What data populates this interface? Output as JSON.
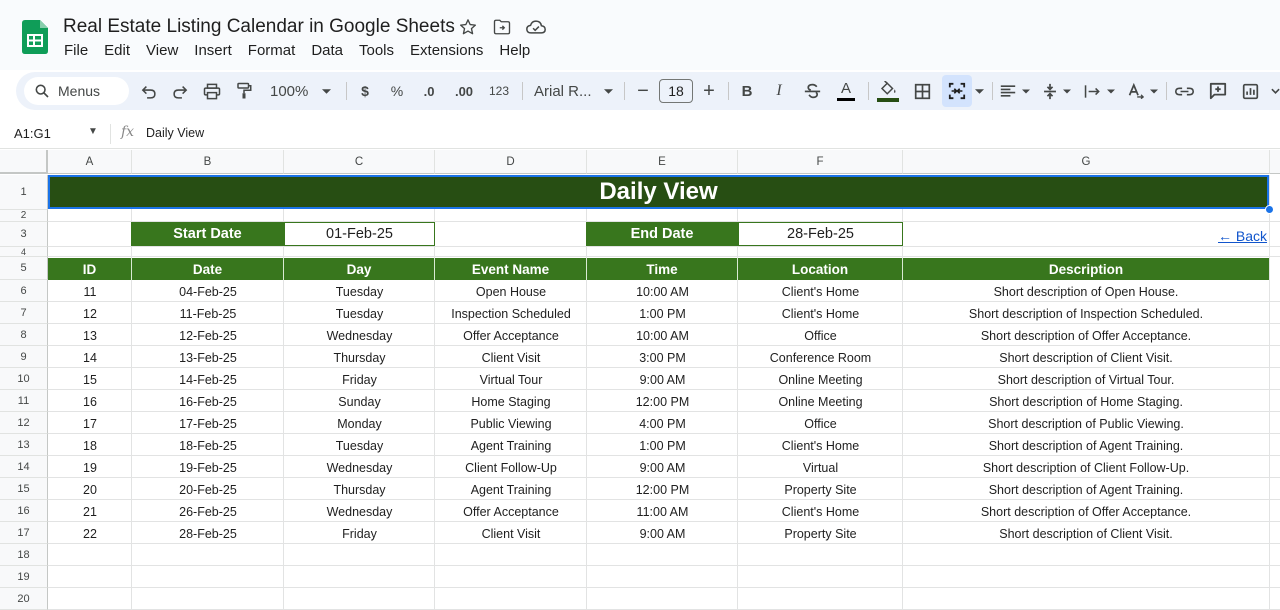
{
  "app": {
    "doc_title": "Real Estate Listing Calendar in Google Sheets",
    "menu": [
      "File",
      "Edit",
      "View",
      "Insert",
      "Format",
      "Data",
      "Tools",
      "Extensions",
      "Help"
    ]
  },
  "toolbar": {
    "menus_label": "Menus",
    "zoom": "100%",
    "currency": "$",
    "percent": "%",
    "dec_decrease": ".0",
    "dec_increase": ".00",
    "number_format": "123",
    "font_name": "Arial R...",
    "font_size": "18",
    "bold": "B",
    "italic": "I",
    "text_color": "A"
  },
  "formula_bar": {
    "name_box": "A1:G1",
    "formula": "Daily View"
  },
  "grid": {
    "columns": [
      "A",
      "B",
      "C",
      "D",
      "E",
      "F",
      "G"
    ],
    "rows": [
      "1",
      "2",
      "3",
      "4",
      "5",
      "6",
      "7",
      "8",
      "9",
      "10",
      "11",
      "12",
      "13",
      "14",
      "15",
      "16",
      "17",
      "18",
      "19",
      "20"
    ]
  },
  "sheet": {
    "banner": "Daily View",
    "start_label": "Start Date",
    "start_value": "01-Feb-25",
    "end_label": "End Date",
    "end_value": "28-Feb-25",
    "back_link": "← Back",
    "headers": [
      "ID",
      "Date",
      "Day",
      "Event Name",
      "Time",
      "Location",
      "Description"
    ],
    "rows": [
      [
        "11",
        "04-Feb-25",
        "Tuesday",
        "Open House",
        "10:00 AM",
        "Client's Home",
        "Short description of Open House."
      ],
      [
        "12",
        "11-Feb-25",
        "Tuesday",
        "Inspection Scheduled",
        "1:00 PM",
        "Client's Home",
        "Short description of Inspection Scheduled."
      ],
      [
        "13",
        "12-Feb-25",
        "Wednesday",
        "Offer Acceptance",
        "10:00 AM",
        "Office",
        "Short description of Offer Acceptance."
      ],
      [
        "14",
        "13-Feb-25",
        "Thursday",
        "Client Visit",
        "3:00 PM",
        "Conference Room",
        "Short description of Client Visit."
      ],
      [
        "15",
        "14-Feb-25",
        "Friday",
        "Virtual Tour",
        "9:00 AM",
        "Online Meeting",
        "Short description of Virtual Tour."
      ],
      [
        "16",
        "16-Feb-25",
        "Sunday",
        "Home Staging",
        "12:00 PM",
        "Online Meeting",
        "Short description of Home Staging."
      ],
      [
        "17",
        "17-Feb-25",
        "Monday",
        "Public Viewing",
        "4:00 PM",
        "Office",
        "Short description of Public Viewing."
      ],
      [
        "18",
        "18-Feb-25",
        "Tuesday",
        "Agent Training",
        "1:00 PM",
        "Client's Home",
        "Short description of Agent Training."
      ],
      [
        "19",
        "19-Feb-25",
        "Wednesday",
        "Client Follow-Up",
        "9:00 AM",
        "Virtual",
        "Short description of Client Follow-Up."
      ],
      [
        "20",
        "20-Feb-25",
        "Thursday",
        "Agent Training",
        "12:00 PM",
        "Property Site",
        "Short description of Agent Training."
      ],
      [
        "21",
        "26-Feb-25",
        "Wednesday",
        "Offer Acceptance",
        "11:00 AM",
        "Client's Home",
        "Short description of Offer Acceptance."
      ],
      [
        "22",
        "28-Feb-25",
        "Friday",
        "Client Visit",
        "9:00 AM",
        "Property Site",
        "Short description of Client Visit."
      ]
    ]
  },
  "colors": {
    "banner_bg": "#274e13",
    "header_bg": "#38761d",
    "selection": "#1a73e8",
    "link": "#1155cc"
  }
}
